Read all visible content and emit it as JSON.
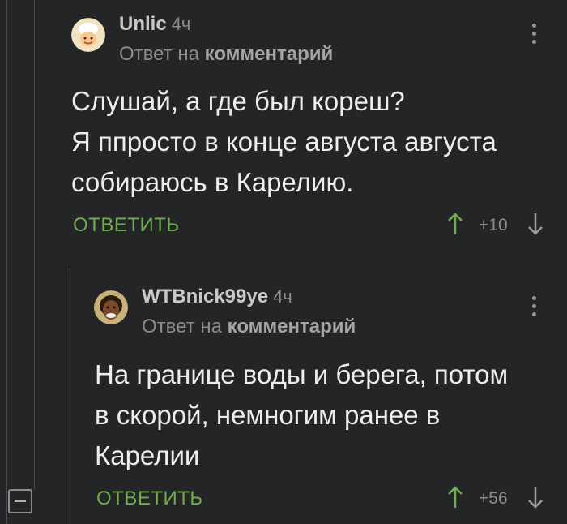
{
  "comments": [
    {
      "author": "Unlic",
      "time": "4ч",
      "reply_prefix": "Ответ на",
      "reply_target": "комментарий",
      "lines": [
        "Слушай, а где был кореш?",
        "Я ппросто в конце августа августа",
        "собираюсь в Карелию."
      ],
      "reply_label": "ОТВЕТИТЬ",
      "rating": "+10"
    },
    {
      "author": "WTBnick99ye",
      "time": "4ч",
      "reply_prefix": "Ответ на",
      "reply_target": "комментарий",
      "lines": [
        "На границе воды и берега, потом",
        "в скорой, немногим ранее в",
        "Карелии"
      ],
      "reply_label": "ОТВЕТИТЬ",
      "rating": "+56"
    }
  ],
  "icons": {
    "upvote": "arrow-up-icon",
    "downvote": "arrow-down-icon",
    "menu": "more-vertical-icon",
    "collapse": "collapse-minus-icon"
  },
  "colors": {
    "background": "#242527",
    "accent_green": "#6fae4b",
    "muted_text": "#8c8c8c"
  }
}
